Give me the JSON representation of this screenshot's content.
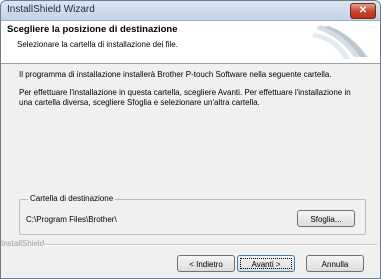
{
  "window": {
    "title": "InstallShield Wizard",
    "close_glyph": "✕"
  },
  "header": {
    "title": "Scegliere la posizione di destinazione",
    "subtitle": "Selezionare la cartella di installazione dei file."
  },
  "body": {
    "paragraph1": "Il programma di installazione installerà Brother P-touch Software nella seguente cartella.",
    "paragraph2": "Per effettuare l'installazione in questa cartella, scegliere Avanti. Per effettuare l'installazione in una cartella diversa, scegliere Sfoglia e selezionare un'altra cartella."
  },
  "destination": {
    "group_label": "Cartella di destinazione",
    "path": "C:\\Program Files\\Brother\\",
    "browse_label": "Sfoglia..."
  },
  "footer": {
    "brand": "InstallShield",
    "back_label": "< Indietro",
    "next_label": "Avanti >",
    "cancel_label": "Annulla"
  },
  "icons": {
    "close": "close-icon",
    "header_graphic": "installer-swoosh-icon"
  }
}
